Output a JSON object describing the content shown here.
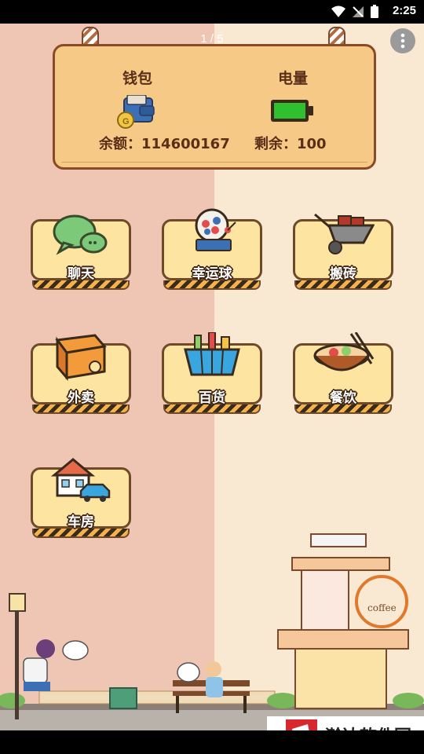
{
  "status_bar": {
    "time": "2:25"
  },
  "page_indicator": "1 / 5",
  "sign": {
    "wallet_label": "钱包",
    "battery_label": "电量",
    "balance_text": "余额：114600167",
    "remaining_text": "剩余：100",
    "battery_level_percent": 100,
    "battery_color": "#2fbf2f"
  },
  "tiles": [
    {
      "label": "聊天",
      "icon": "chat-bubbles-icon"
    },
    {
      "label": "幸运球",
      "icon": "lucky-ball-machine-icon"
    },
    {
      "label": "搬砖",
      "icon": "brick-wheelbarrow-icon"
    },
    {
      "label": "外卖",
      "icon": "delivery-box-icon"
    },
    {
      "label": "百货",
      "icon": "shopping-basket-icon"
    },
    {
      "label": "餐饮",
      "icon": "food-bowl-icon"
    },
    {
      "label": "车房",
      "icon": "house-car-icon"
    }
  ],
  "scene": {
    "shop_sign": "coffee"
  },
  "watermark": {
    "text": "瀚达软件园"
  },
  "colors": {
    "bg_left": "#efc6b3",
    "bg_right": "#f9e8d2",
    "board": "#f7c987",
    "tile_face": "#fde5a1"
  }
}
